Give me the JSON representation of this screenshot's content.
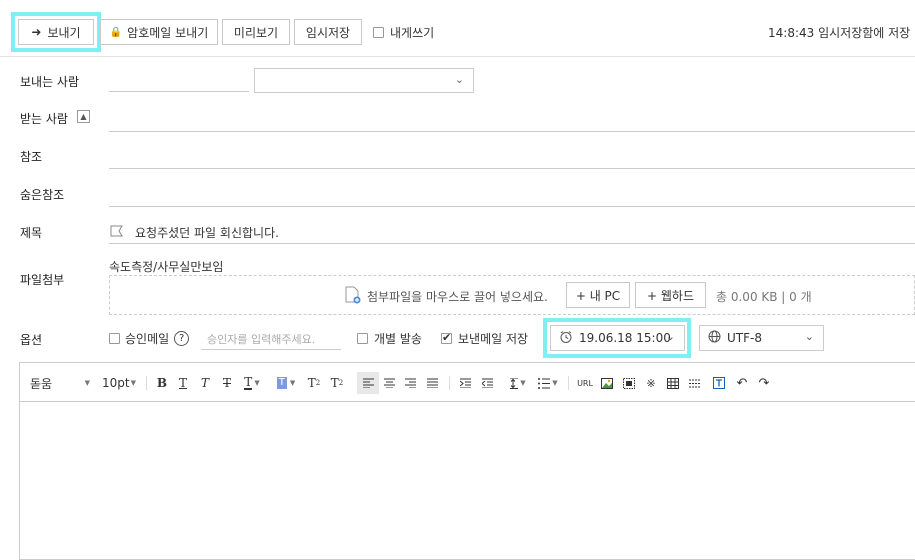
{
  "toolbar": {
    "send_label": "보내기",
    "secure_send_label": "암호메일 보내기",
    "preview_label": "미리보기",
    "temp_save_label": "임시저장",
    "to_me_label": "내게쓰기",
    "autosave_status": "14:8:43 임시저장함에 저장"
  },
  "fields": {
    "sender_label": "보내는 사람",
    "recipient_label": "받는 사람",
    "cc_label": "참조",
    "bcc_label": "숨은참조",
    "subject_label": "제목",
    "subject_value": "요청주셨던 파일 회신합니다.",
    "attach_label": "파일첨부",
    "attach_name": "속도측정/사무실만보임",
    "attach_drop_hint": "첨부파일을 마우스로 끌어 넣으세요.",
    "attach_pc_label": "+ 내 PC",
    "attach_webhard_label": "+ 웹하드",
    "attach_total": "총 0.00 KB | 0 개",
    "options_label": "옵션"
  },
  "options": {
    "approval_label": "승인메일",
    "approver_placeholder": "승인자를 입력해주세요.",
    "individual_send_label": "개별 발송",
    "save_sent_label": "보낸메일 저장",
    "save_sent_checked": true,
    "scheduled_time": "19.06.18 15:00",
    "encoding": "UTF-8"
  },
  "editor": {
    "font_family": "돋움",
    "font_size": "10pt",
    "url_label": "URL"
  },
  "colors": {
    "highlight": "#7eeff2",
    "border": "#cccccc"
  }
}
